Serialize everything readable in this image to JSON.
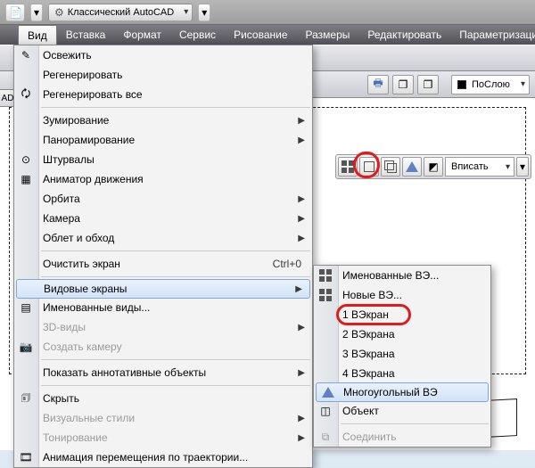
{
  "titlebar": {
    "workspace_label": "Классический AutoCAD"
  },
  "menubar": {
    "items": [
      "Вид",
      "Вставка",
      "Формат",
      "Сервис",
      "Рисование",
      "Размеры",
      "Редактировать",
      "Параметризация"
    ],
    "active_index": 0
  },
  "toolstrip2": {
    "bylayer_label": "ПоСлою"
  },
  "canvas": {
    "panel_tab": "AD"
  },
  "view_menu": {
    "refresh": "Освежить",
    "regen": "Регенерировать",
    "regen_all": "Регенерировать все",
    "zoom": "Зумирование",
    "pan": "Панорамирование",
    "steering": "Штурвалы",
    "motion": "Аниматор движения",
    "orbit": "Орбита",
    "camera": "Камера",
    "walkfly": "Облет и обход",
    "clean": "Очистить экран",
    "clean_shortcut": "Ctrl+0",
    "viewports": "Видовые экраны",
    "named_views": "Именованные виды...",
    "views3d": "3D-виды",
    "create_cam": "Создать камеру",
    "anno": "Показать аннотативные объекты",
    "hide": "Скрыть",
    "vstyles": "Визуальные стили",
    "render": "Тонирование",
    "motionpath": "Анимация перемещения по траектории..."
  },
  "viewports_submenu": {
    "named": "Именованные ВЭ...",
    "new": "Новые ВЭ...",
    "one": "1 ВЭкран",
    "two": "2 ВЭкрана",
    "three": "3 ВЭкрана",
    "four": "4 ВЭкрана",
    "poly": "Многоугольный ВЭ",
    "object": "Объект",
    "join": "Соединить"
  },
  "vp_toolbar": {
    "scale_label": "Вписать"
  }
}
